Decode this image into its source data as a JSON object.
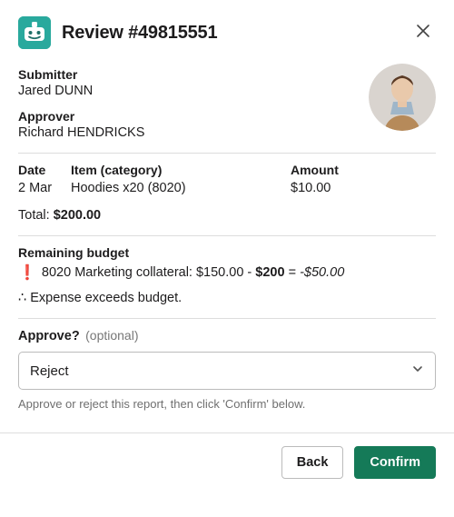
{
  "header": {
    "title": "Review #49815551"
  },
  "submitter": {
    "label": "Submitter",
    "value": "Jared DUNN"
  },
  "approver": {
    "label": "Approver",
    "value": "Richard HENDRICKS"
  },
  "columns": {
    "date": "Date",
    "item": "Item (category)",
    "amount": "Amount"
  },
  "row": {
    "date": "2 Mar",
    "item": "Hoodies x20 (8020)",
    "amount": "$10.00"
  },
  "total": {
    "label": "Total: ",
    "amount": "$200.00"
  },
  "budget": {
    "heading": "Remaining budget",
    "line_prefix": "8020 Marketing collateral: $150.00 - ",
    "expense_bold": "$200",
    "equals": " = ",
    "result_italic": "-$50.00",
    "conclusion_prefix": "∴ ",
    "conclusion": "Expense exceeds budget."
  },
  "approve": {
    "question": "Approve?",
    "optional": "(optional)",
    "selected": "Reject",
    "helper": "Approve or reject this report, then click 'Confirm' below."
  },
  "buttons": {
    "back": "Back",
    "confirm": "Confirm"
  }
}
